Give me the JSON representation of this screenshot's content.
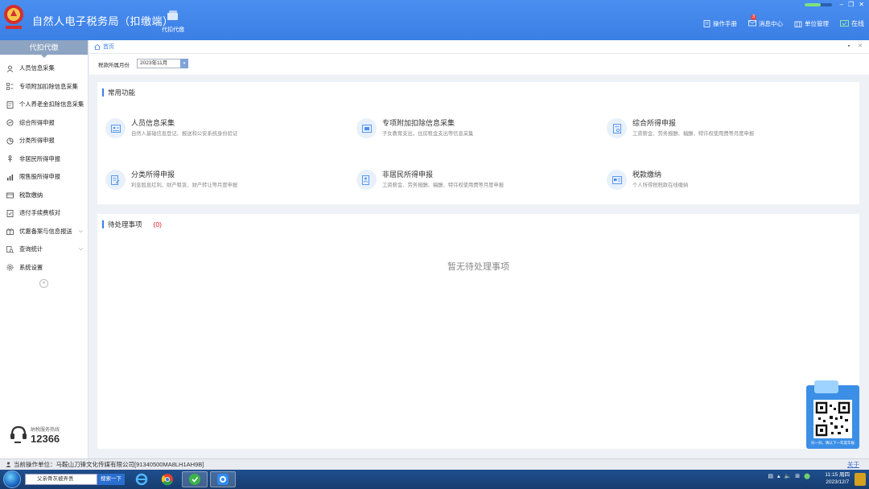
{
  "header": {
    "title": "自然人电子税务局（扣缴端）",
    "nav_item": "代扣代缴",
    "tools": [
      {
        "icon": "manual-icon",
        "label": "操作手册"
      },
      {
        "icon": "message-icon",
        "label": "消息中心",
        "badge": "3"
      },
      {
        "icon": "building-icon",
        "label": "单位管理"
      },
      {
        "icon": "online-icon",
        "label": "在线"
      }
    ]
  },
  "sidebar": {
    "title": "代扣代缴",
    "items": [
      {
        "label": "人员信息采集",
        "icon": "user-icon"
      },
      {
        "label": "专项附加扣除信息采集",
        "icon": "list-icon"
      },
      {
        "label": "个人养老金扣除信息采集",
        "icon": "doc-icon"
      },
      {
        "label": "综合所得申报",
        "icon": "chart-icon"
      },
      {
        "label": "分类所得申报",
        "icon": "pie-icon"
      },
      {
        "label": "非居民所得申报",
        "icon": "person-icon"
      },
      {
        "label": "限售股所得申报",
        "icon": "bars-icon"
      },
      {
        "label": "税款缴纳",
        "icon": "wallet-icon"
      },
      {
        "label": "退付手续费核对",
        "icon": "check-doc-icon"
      },
      {
        "label": "优惠备案与信息报送",
        "icon": "gift-icon",
        "expandable": true
      },
      {
        "label": "查询统计",
        "icon": "search-doc-icon",
        "expandable": true
      },
      {
        "label": "系统设置",
        "icon": "gear-icon"
      }
    ],
    "hotline_label": "纳税服务热线",
    "hotline_number": "12366"
  },
  "tab": {
    "label": "首页"
  },
  "filter": {
    "label": "税款所属月份",
    "value": "2023年11月"
  },
  "common": {
    "title": "常用功能",
    "features": [
      {
        "title": "人员信息采集",
        "desc": "自然人基础信息登记、报送和公安系统身份验证"
      },
      {
        "title": "专项附加扣除信息采集",
        "desc": "子女教育支出，住房租金支出等信息采集"
      },
      {
        "title": "综合所得申报",
        "desc": "工资薪金、劳务报酬、稿酬、特许权使用费等月度申报"
      },
      {
        "title": "分类所得申报",
        "desc": "利息股息红利、财产租赁、财产转让等月度申报"
      },
      {
        "title": "非居民所得申报",
        "desc": "工资薪金、劳务报酬、稿酬、特许权使用费等月度申报"
      },
      {
        "title": "税款缴纳",
        "desc": "个人所得税税款在线缴纳"
      }
    ]
  },
  "pending": {
    "title": "待处理事项",
    "count": "(0)",
    "empty": "暂无待处理事项"
  },
  "qr": {
    "caption": "扫一扫，确认下一年度年报"
  },
  "status": {
    "current_unit": "当前操作单位：马鞍山刀锋文化传媒有限公司[91340500MA8LH1AH9B]",
    "about": "关于"
  },
  "taskbar": {
    "search_value": "父亲骨灰被弄丢",
    "search_button": "搜索一下",
    "time": "11:15 周四",
    "date": "2023/12/7"
  }
}
